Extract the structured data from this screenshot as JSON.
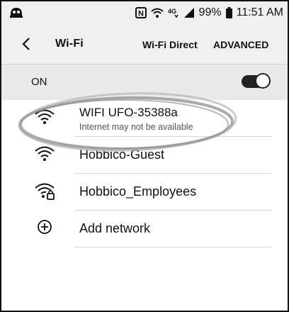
{
  "status_bar": {
    "nfc": "N",
    "network_badge": "4G",
    "battery": "99%",
    "time": "11:51 AM"
  },
  "header": {
    "title": "Wi-Fi",
    "wifi_direct": "Wi-Fi Direct",
    "advanced": "ADVANCED"
  },
  "toggle": {
    "label": "ON",
    "state": "on"
  },
  "networks": [
    {
      "name": "WIFI UFO-35388a",
      "status": "Internet may not be available",
      "icon": "wifi-icon"
    },
    {
      "name": "Hobbico-Guest",
      "icon": "wifi-icon"
    },
    {
      "name": "Hobbico_Employees",
      "icon": "wifi-locked-icon"
    }
  ],
  "add_network": {
    "label": "Add network",
    "icon": "add-circle-icon"
  },
  "colors": {
    "status_bar_bg": "#f0f0f0",
    "toggle_row_bg": "#e9e9e9",
    "text": "#111111",
    "secondary_text": "#555555"
  }
}
